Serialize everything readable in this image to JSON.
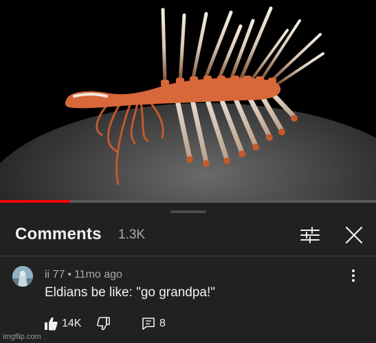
{
  "video": {
    "progress_fraction": 0.186,
    "colors": {
      "progress": "#ff0000",
      "track": "#5a5a5a",
      "creature": "#d8673a",
      "spine": "#e8d9c8"
    }
  },
  "comments_panel": {
    "title": "Comments",
    "count": "1.3K",
    "filter_icon": "sliders-icon",
    "close_icon": "close-icon"
  },
  "comment": {
    "author": "ii 77",
    "separator": "•",
    "time_ago": "11mo ago",
    "text": "Eldians be like: \"go grandpa!\"",
    "likes": "14K",
    "replies": "8",
    "icons": [
      "thumbs-up-icon",
      "thumbs-down-icon",
      "reply-icon",
      "more-vertical-icon"
    ]
  },
  "watermark": "imgflip.com"
}
